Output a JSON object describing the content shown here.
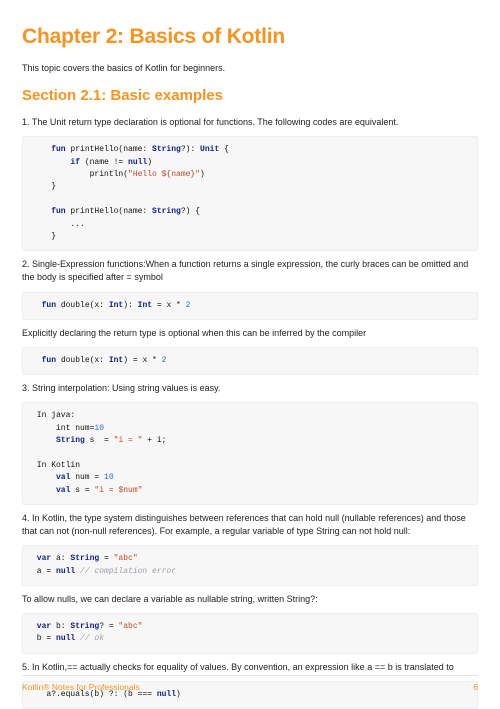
{
  "chapter_title": "Chapter 2: Basics of Kotlin",
  "intro": "This topic covers the basics of Kotlin for beginners.",
  "section_title": "Section 2.1: Basic examples",
  "p1": "1. The Unit return type declaration is optional for functions. The following codes are equivalent.",
  "p2": "2. Single-Expression functions:When a function returns a single expression, the curly braces can be omitted and the body is specified after = symbol",
  "p3": "Explicitly declaring the return type is optional when this can be inferred by the compiler",
  "p4": "3. String interpolation: Using string values is easy.",
  "p5": "4. In Kotlin, the type system distinguishes between references that can hold null (nullable references) and those that can not (non-null references). For example, a regular variable of type String can not hold null:",
  "p6": "To allow nulls, we can declare a variable as nullable string, written String?:",
  "p7": "5. In Kotlin,== actually checks for equality of values. By convention, an expression like a == b is translated to",
  "code1": {
    "l1a": "    fun",
    "l1b": " printHello(name: ",
    "l1c": "String",
    "l1d": "?): ",
    "l1e": "Unit",
    "l1f": " {",
    "l2a": "        if",
    "l2b": " (name != ",
    "l2c": "null",
    "l2d": ")",
    "l3a": "            println(",
    "l3b": "\"Hello ",
    "l3c": "${name}",
    "l3d": "\"",
    "l3e": ")",
    "l4": "    }",
    "l5": "",
    "l6a": "    fun",
    "l6b": " printHello(name: ",
    "l6c": "String",
    "l6d": "?) {",
    "l7": "        ...",
    "l8": "    }"
  },
  "code2": {
    "a": "  fun",
    "b": " double(x: ",
    "c": "Int",
    "d": "): ",
    "e": "Int",
    "f": " = x * ",
    "g": "2"
  },
  "code3": {
    "a": "  fun",
    "b": " double(x: ",
    "c": "Int",
    "d": ") = x * ",
    "e": "2"
  },
  "code4": {
    "l1": " In java:",
    "l2a": "     int num=",
    "l2b": "10",
    "l3a": "     ",
    "l3b": "String",
    "l3c": " s  = ",
    "l3d": "\"i = \"",
    "l3e": " + i;",
    "l4": "",
    "l5": " In Kotlin",
    "l6a": "     val",
    "l6b": " num = ",
    "l6c": "10",
    "l7a": "     val",
    "l7b": " s = ",
    "l7c": "\"i = ",
    "l7d": "$num",
    "l7e": "\""
  },
  "code5": {
    "a": " var",
    "b": " a: ",
    "c": "String",
    "d": " = ",
    "e": "\"abc\"",
    "f": " a = ",
    "g": "null",
    "h": " // compilation error"
  },
  "code6": {
    "a": " var",
    "b": " b: ",
    "c": "String",
    "d": "? = ",
    "e": "\"abc\"",
    "f": " b = ",
    "g": "null",
    "h": " // ok"
  },
  "code7": {
    "a": "   a?.equals(b) ?: (b === ",
    "b": "null",
    "c": ")"
  },
  "footer_left": "Kotlin® Notes for Professionals",
  "footer_right": "6"
}
